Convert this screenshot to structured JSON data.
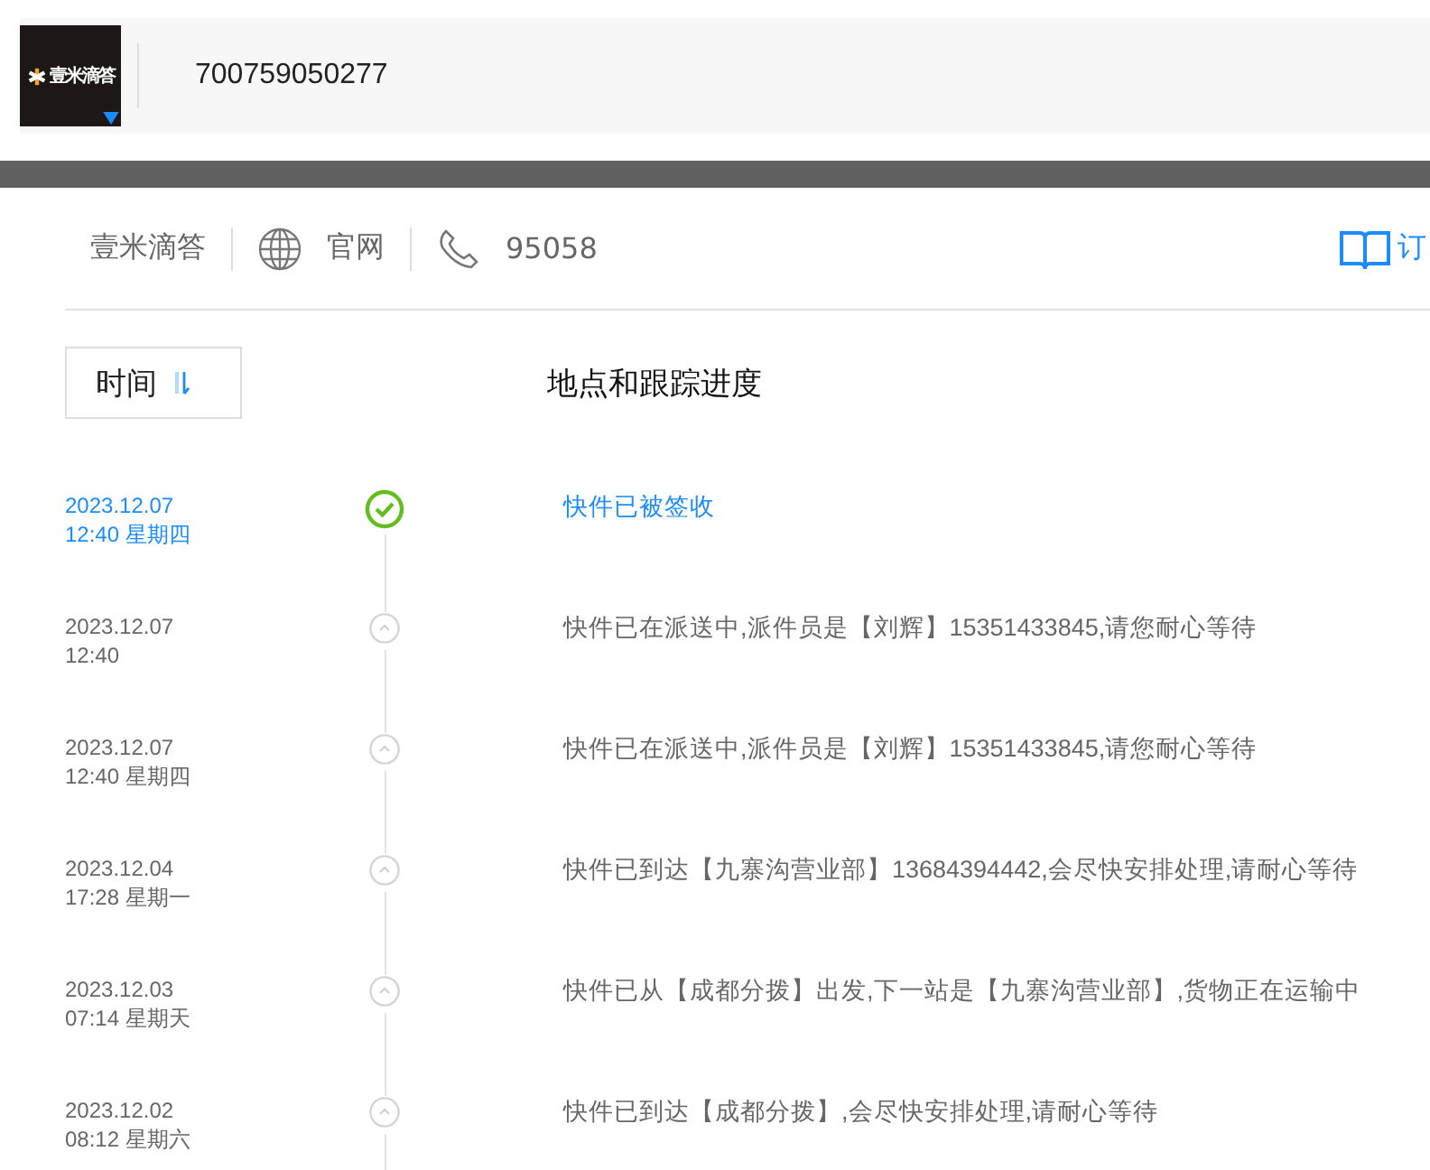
{
  "header": {
    "logo_text": "壹米滴答",
    "tracking_number": "700759050277"
  },
  "company": {
    "name": "壹米滴答",
    "website": "官网",
    "phone": "95058",
    "subscribe": "订"
  },
  "table": {
    "sort_button": "时间",
    "column_header": "地点和跟踪进度",
    "rows": [
      {
        "kind": "signed",
        "date": "2023.12.07",
        "time": "12:40 星期四",
        "text": "快件已被签收"
      },
      {
        "kind": "transit",
        "date": "2023.12.07",
        "time": "12:40",
        "text": "快件已在派送中,派件员是【刘辉】15351433845,请您耐心等待"
      },
      {
        "kind": "transit",
        "date": "2023.12.07",
        "time": "12:40 星期四",
        "text": "快件已在派送中,派件员是【刘辉】15351433845,请您耐心等待"
      },
      {
        "kind": "transit",
        "date": "2023.12.04",
        "time": "17:28 星期一",
        "text": "快件已到达【九寨沟营业部】13684394442,会尽快安排处理,请耐心等待"
      },
      {
        "kind": "transit",
        "date": "2023.12.03",
        "time": "07:14 星期天",
        "text": "快件已从【成都分拨】出发,下一站是【九寨沟营业部】,货物正在运输中"
      },
      {
        "kind": "transit",
        "date": "2023.12.02",
        "time": "08:12 星期六",
        "text": "快件已到达【成都分拨】,会尽快安排处理,请耐心等待"
      }
    ]
  }
}
